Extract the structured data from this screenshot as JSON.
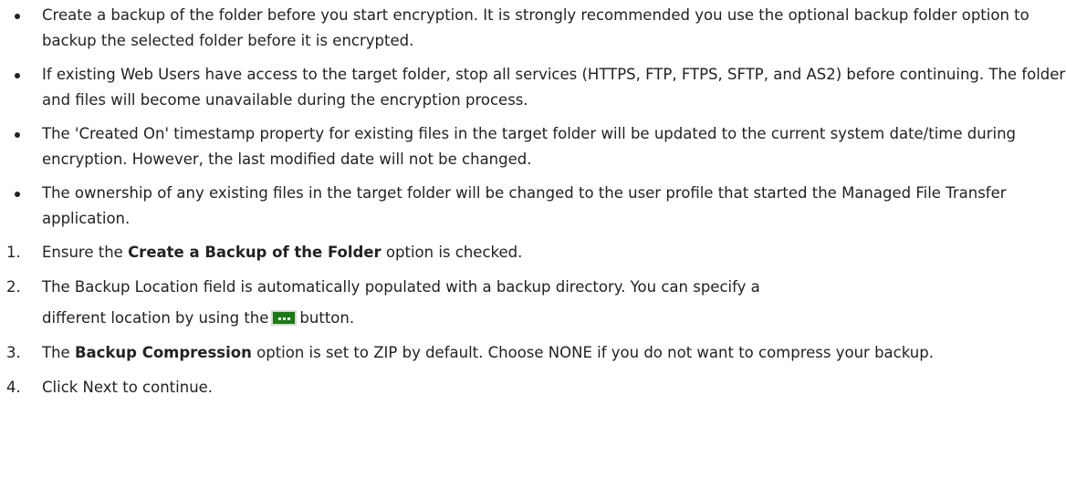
{
  "bullets": [
    {
      "text": "Create a backup of the folder before you start encryption. It is strongly recommended you use the optional backup folder option to backup the selected folder before it is encrypted."
    },
    {
      "text": "If existing Web Users have access to the target folder, stop all services (HTTPS, FTP, FTPS, SFTP, and AS2) before continuing. The folder and files will become unavailable during the encryption process."
    },
    {
      "text": "The 'Created On' timestamp property for existing files in the target folder will be updated to the current system date/time during encryption. However, the last modified date will not be changed."
    },
    {
      "text": "The ownership of any existing files in the target folder will be changed to the user profile that started the Managed File Transfer application."
    }
  ],
  "steps": [
    {
      "num": "1.",
      "pre": "Ensure the ",
      "bold": "Create a Backup of the Folder",
      "post": " option is checked."
    },
    {
      "num": "2.",
      "line1": "The Backup Location field is automatically populated with a backup directory. You can specify a",
      "line2_pre": "different location by using the",
      "line2_post": "button.",
      "button_icon": "ellipsis-button-icon"
    },
    {
      "num": "3.",
      "pre": "The ",
      "bold": "Backup Compression",
      "post": " option is set to ZIP by default. Choose NONE if you do not want to compress your backup."
    },
    {
      "num": "4.",
      "text": "Click Next to continue."
    }
  ],
  "colors": {
    "text": "#222222",
    "button_green": "#1c7a16"
  }
}
